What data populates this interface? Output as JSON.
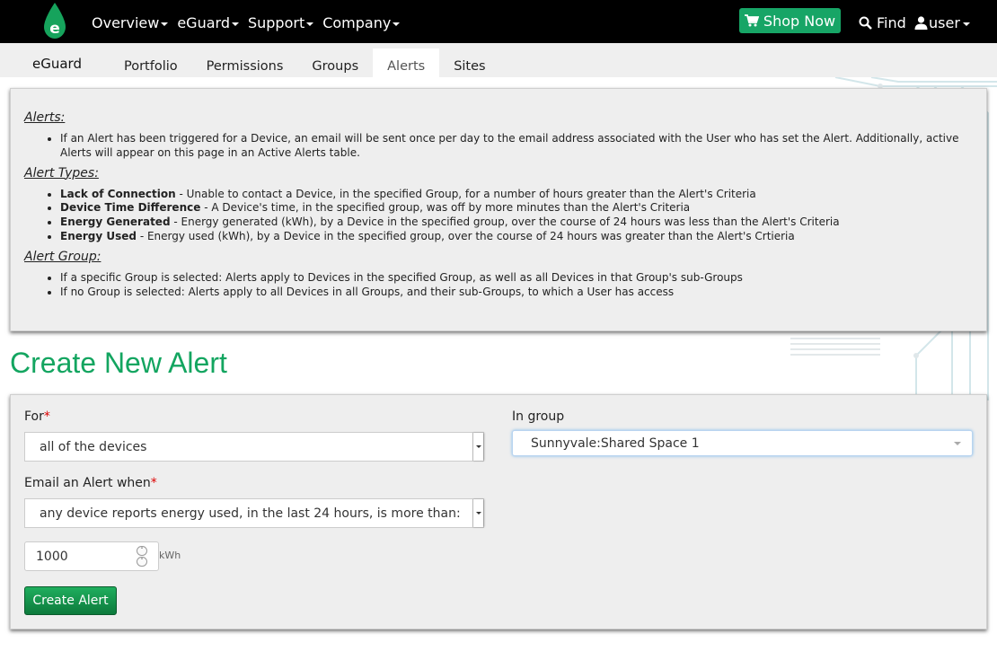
{
  "navbar": {
    "menu": [
      "Overview",
      "eGuard",
      "Support",
      "Company"
    ],
    "shop_label": "Shop Now",
    "find_label": "Find",
    "user_label": "user"
  },
  "subnav": {
    "title": "eGuard",
    "tabs": [
      "Portfolio",
      "Permissions",
      "Groups",
      "Alerts",
      "Sites"
    ],
    "active_tab": "Alerts"
  },
  "info": {
    "alerts_heading": "Alerts:",
    "alerts_text": "If an Alert has been triggered for a Device, an email will be sent once per day to the email address associated with the User who has set the Alert. Additionally, active Alerts will appear on this page in an Active Alerts table.",
    "types_heading": "Alert Types:",
    "types": [
      {
        "name": "Lack of Connection",
        "desc": " - Unable to contact a Device, in the specified Group, for a number of hours greater than the Alert's Criteria"
      },
      {
        "name": "Device Time Difference",
        "desc": " - A Device's time, in the specified group, was off by more minutes than the Alert's Criteria"
      },
      {
        "name": "Energy Generated",
        "desc": " - Energy generated (kWh), by a Device in the specified group, over the course of 24 hours was less than the Alert's Criteria"
      },
      {
        "name": "Energy Used",
        "desc": " - Energy used (kWh), by a Device in the specified group, over the course of 24 hours was greater than the Alert's Crtieria"
      }
    ],
    "group_heading": "Alert Group:",
    "group_items": [
      "If a specific Group is selected: Alerts apply to Devices in the specified Group, as well as all Devices in that Group's sub-Groups",
      "If no Group is selected: Alerts apply to all Devices in all Groups, and their sub-Groups, to which a User has access"
    ]
  },
  "page_title": "Create New Alert",
  "form": {
    "for_label": "For",
    "for_value": "all of the devices",
    "group_label": "In group",
    "group_value": "Sunnyvale:Shared Space 1",
    "when_label": "Email an Alert when",
    "when_value": "any device reports energy used, in the last 24 hours, is more than:",
    "amount_value": "1000",
    "unit": "kWh",
    "submit_label": "Create Alert",
    "required_mark": "*"
  },
  "colors": {
    "accent": "#13a560",
    "navbar": "#000000",
    "panel": "#eeeeee"
  }
}
